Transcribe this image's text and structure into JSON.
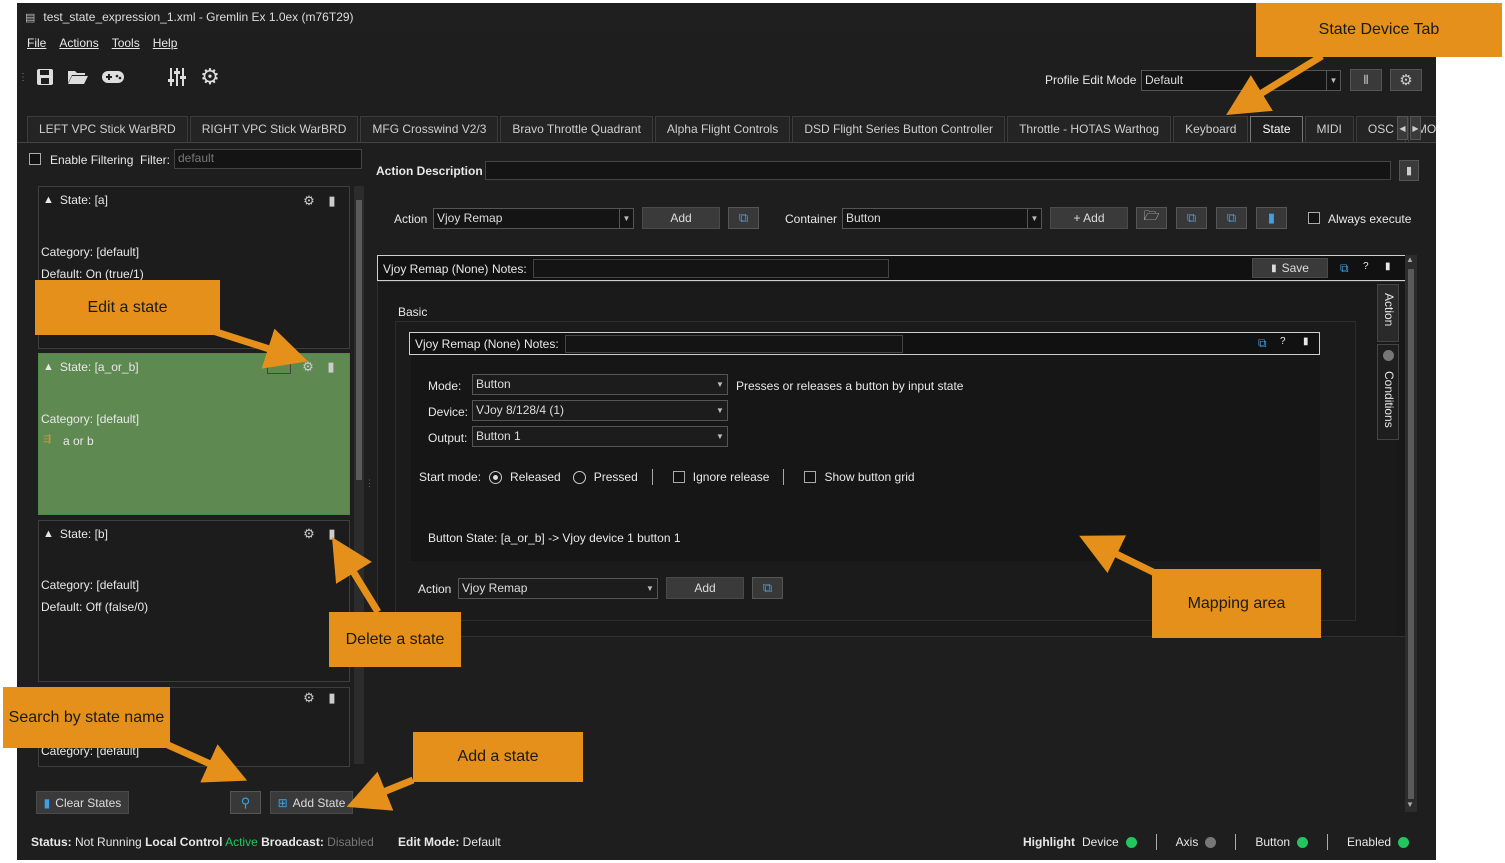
{
  "window": {
    "title": "test_state_expression_1.xml - Gremlin Ex 1.0ex (m76T29)"
  },
  "menu": [
    "File",
    "Actions",
    "Tools",
    "Help"
  ],
  "toolbar": {
    "profile_edit_mode_label": "Profile Edit Mode",
    "profile_edit_mode_value": "Default"
  },
  "tabs": [
    "LEFT VPC Stick WarBRD",
    "RIGHT VPC Stick WarBRD",
    "MFG Crosswind V2/3",
    "Bravo Throttle Quadrant",
    "Alpha Flight Controls",
    "DSD Flight Series Button Controller",
    "Throttle - HOTAS Warthog",
    "Keyboard",
    "State",
    "MIDI",
    "OSC",
    "MODE"
  ],
  "active_tab": "State",
  "filter": {
    "enable_label": "Enable Filtering",
    "filter_label": "Filter:",
    "placeholder": "default"
  },
  "states": [
    {
      "title": "State: [a]",
      "category": "Category: [default]",
      "detail": "Default: On (true/1)",
      "selected": false
    },
    {
      "title": "State: [a_or_b]",
      "category": "Category: [default]",
      "detail": "a or b",
      "selected": true
    },
    {
      "title": "State: [b]",
      "category": "Category: [default]",
      "detail": "Default: Off (false/0)",
      "selected": false
    },
    {
      "title": "",
      "category": "Category: [default]",
      "detail": "",
      "selected": false
    }
  ],
  "left_buttons": {
    "clear": "Clear States",
    "add": "Add State"
  },
  "action_description_label": "Action Description",
  "action_bar": {
    "action_label": "Action",
    "action_value": "Vjoy Remap",
    "add": "Add",
    "container_label": "Container",
    "container_value": "Button",
    "container_add": "+ Add",
    "always_execute": "Always execute"
  },
  "container_header": {
    "title": "Vjoy Remap (None)",
    "notes_label": "Notes:",
    "save": "Save"
  },
  "basic_label": "Basic",
  "inner_header": {
    "title": "Vjoy Remap (None)",
    "notes_label": "Notes:"
  },
  "mapping": {
    "mode_label": "Mode:",
    "mode_value": "Button",
    "mode_desc": "Presses or releases a button by input state",
    "device_label": "Device:",
    "device_value": "VJoy 8/128/4 (1)",
    "output_label": "Output:",
    "output_value": "Button 1",
    "start_mode_label": "Start mode:",
    "released": "Released",
    "pressed": "Pressed",
    "ignore_release": "Ignore release",
    "show_button_grid": "Show button grid",
    "button_state": "Button State: [a_or_b] -> Vjoy device 1 button 1"
  },
  "bottom_action": {
    "label": "Action",
    "value": "Vjoy Remap",
    "add": "Add"
  },
  "side_tabs": [
    "Action",
    "Conditions"
  ],
  "status": {
    "status_label": "Status:",
    "status_value": "Not Running",
    "local_label": "Local Control",
    "local_value": "Active",
    "broadcast_label": "Broadcast:",
    "broadcast_value": "Disabled",
    "edit_mode_label": "Edit Mode:",
    "edit_mode_value": "Default",
    "highlight": "Highlight",
    "device": "Device",
    "axis": "Axis",
    "button": "Button",
    "enabled": "Enabled"
  },
  "colors": {
    "accent_green": "#22c55e",
    "callout": "#e4901b",
    "active_state": "#5e8a52"
  },
  "callouts": {
    "state_device_tab": "State Device Tab",
    "edit_state": "Edit a state",
    "delete_state": "Delete a state",
    "search": "Search by state name",
    "add_state": "Add a state",
    "mapping_area": "Mapping area"
  }
}
